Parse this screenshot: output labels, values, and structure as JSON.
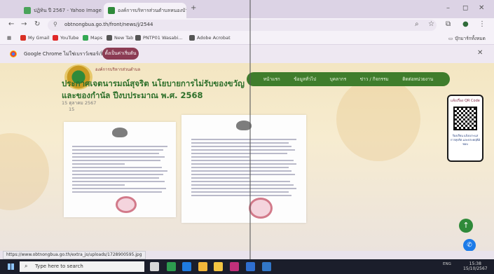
{
  "browser": {
    "tabs": [
      {
        "title": "ปฏิทิน ปี 2567 - Yahoo Image Se...",
        "active": false,
        "favicon_color": "#4aa35a"
      },
      {
        "title": "องค์การบริหารส่วนตำบลหนองบัวแต...",
        "active": true,
        "favicon_color": "#2f8a3a"
      }
    ],
    "new_tab": "+",
    "window_controls": {
      "minimize": "–",
      "maximize": "◻",
      "close": "✕"
    },
    "url": "obtnongbua.go.th/front/news/j/2544",
    "nav": {
      "back": "←",
      "forward": "→",
      "reload": "↻"
    },
    "toolbar_icons": {
      "search": "⌕",
      "bookmark_star": "☆",
      "extensions": "⧉",
      "profile": "●",
      "menu": "⋮"
    },
    "bookmarks": [
      {
        "label": "My Gmail",
        "color": "#d93025"
      },
      {
        "label": "YouTube",
        "color": "#e02828"
      },
      {
        "label": "Maps",
        "color": "#34a853"
      },
      {
        "label": "New Tab",
        "color": "#555555"
      },
      {
        "label": "PNTP01 Wasabi...",
        "color": "#555555"
      },
      {
        "label": "Adobe Acrobat",
        "color": "#555555"
      }
    ],
    "bookmarks_right": "บุ๊กมาร์กทั้งหมด",
    "infobar": {
      "message": "Google Chrome ไม่ใช่เบราว์เซอร์เริ่มต้น",
      "button": "ตั้งเป็นค่าเริ่มต้น",
      "close": "✕"
    }
  },
  "page": {
    "site_name": "องค์การบริหารส่วนตำบล",
    "nav_items": [
      "หน้าแรก",
      "ข้อมูลทั่วไป",
      "บุคลากร",
      "ข่าว / กิจกรรม",
      "ติดต่อหน่วยงาน"
    ],
    "headline": "ประกาศเจตนารมณ์สุจริต นโยบายการไม่รับของขวัญ และของกำนัล ปีงบประมาณ พ.ศ. 2568",
    "date": "15 ตุลาคม 2567",
    "views": "15",
    "qr_card": {
      "title": "แจ้งเรื่อง QR Code",
      "text": "ร้องเรียน แจ้งเบาะแส การทุจริต และประพฤติมิชอบ"
    },
    "fab_up": "↑",
    "fab_chat": "✆"
  },
  "status_bar_url": "https://www.obtnongbua.go.th/extra_js/uploads/1728900595.jpg",
  "taskbar": {
    "search_placeholder": "Type here to search",
    "tray_text": "ENG",
    "time": "15:38",
    "date": "15/10/2567",
    "app_colors": [
      "#d8d8d8",
      "#2d9c4f",
      "#1f7be0",
      "#f2b63a",
      "#f4c542",
      "#c0307a",
      "#2f6fd1",
      "#3277c8"
    ]
  }
}
